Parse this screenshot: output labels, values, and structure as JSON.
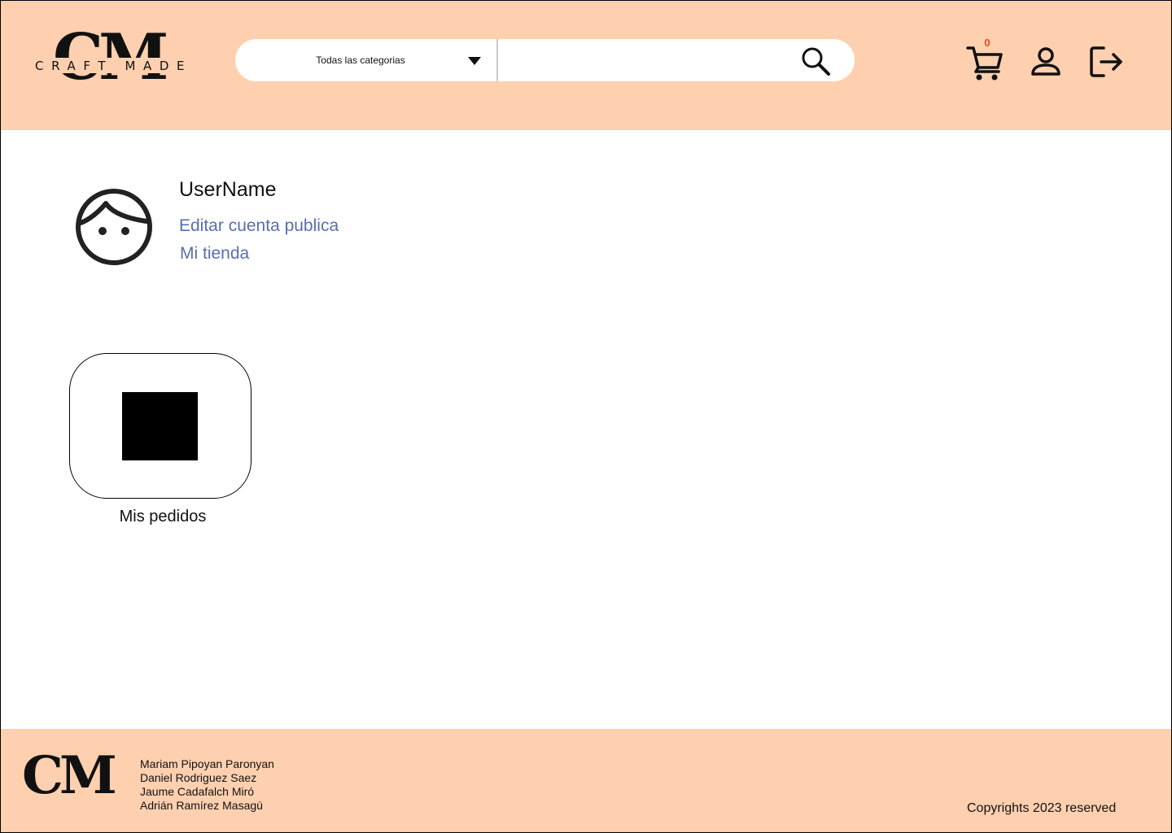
{
  "brand": {
    "logo_letters": "CM",
    "logo_subtitle": "CRAFT MADE"
  },
  "header": {
    "category_select": {
      "selected": "Todas las categorias"
    },
    "search": {
      "value": "",
      "placeholder": ""
    },
    "cart": {
      "count": "0"
    },
    "icons": [
      "search-icon",
      "cart-icon",
      "user-icon",
      "logout-icon"
    ]
  },
  "profile": {
    "username": "UserName",
    "edit_link": "Editar cuenta publica",
    "shop_link": "Mi tienda"
  },
  "orders_card": {
    "label": "Mis pedidos"
  },
  "footer": {
    "logo_letters": "CM",
    "authors": [
      "Mariam Pipoyan Paronyan",
      "Daniel Rodriguez Saez",
      "Jaume Cadafalch Miró",
      "Adrián Ramírez Masagú"
    ],
    "copyright": "Copyrights 2023 reserved"
  },
  "colors": {
    "header_bg": "#ffd0af",
    "link": "#5a6eae",
    "cart_badge": "#e74a1c",
    "text": "#111111"
  }
}
